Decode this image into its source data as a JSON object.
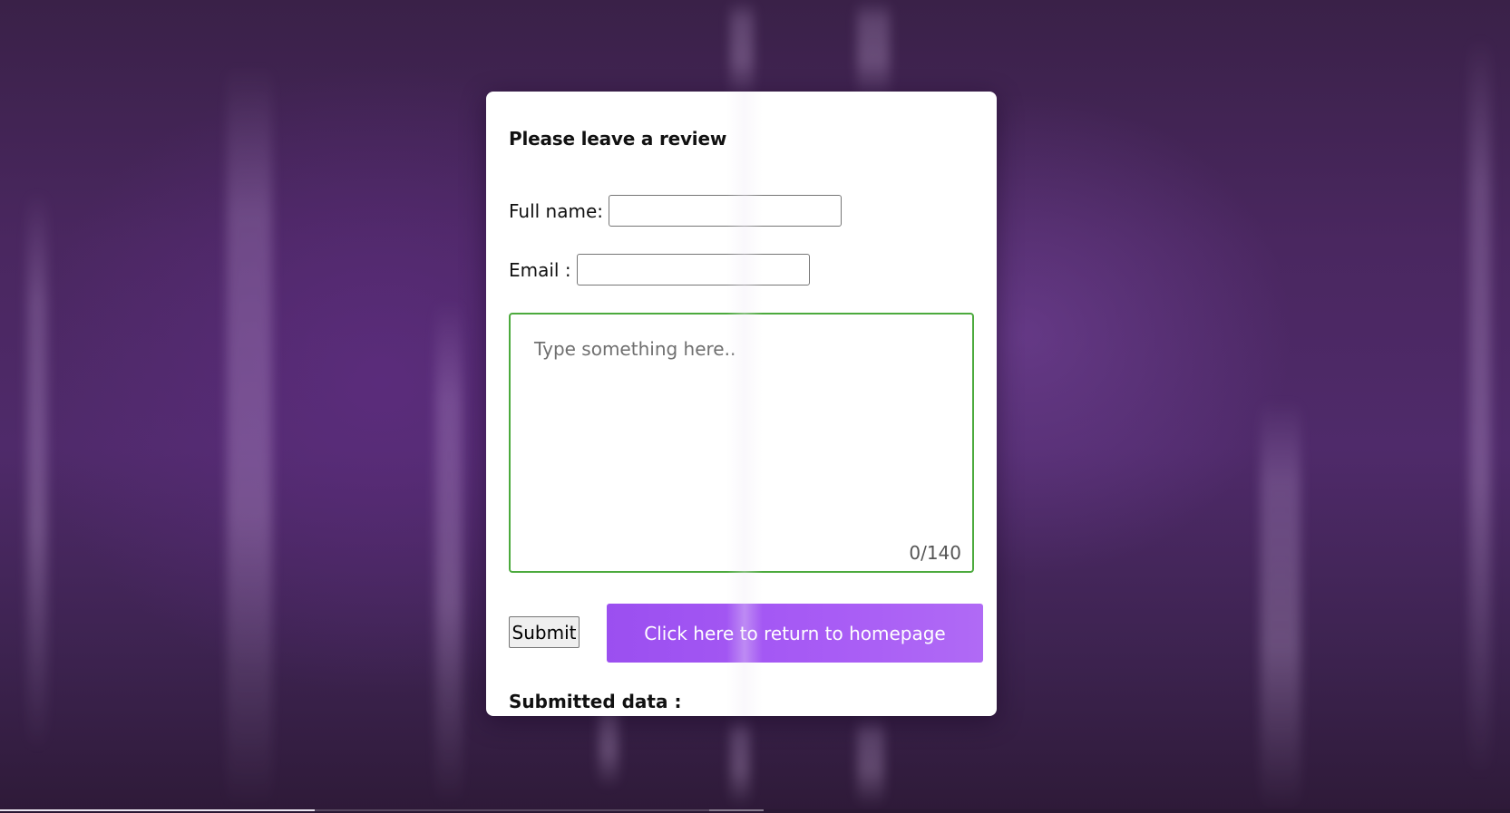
{
  "form": {
    "title": "Please leave a review",
    "full_name": {
      "label": "Full name:",
      "value": "",
      "placeholder": ""
    },
    "email": {
      "label": "Email :",
      "value": "",
      "placeholder": ""
    },
    "review": {
      "placeholder": "Type something here..",
      "value": "",
      "char_count": "0/140"
    },
    "submit_label": "Submit",
    "home_label": "Click here to return to homepage",
    "submitted_label": "Submitted data :"
  },
  "colors": {
    "review_border": "#4caa3d",
    "home_button": "#a85cf5",
    "background": "#4a2760"
  }
}
